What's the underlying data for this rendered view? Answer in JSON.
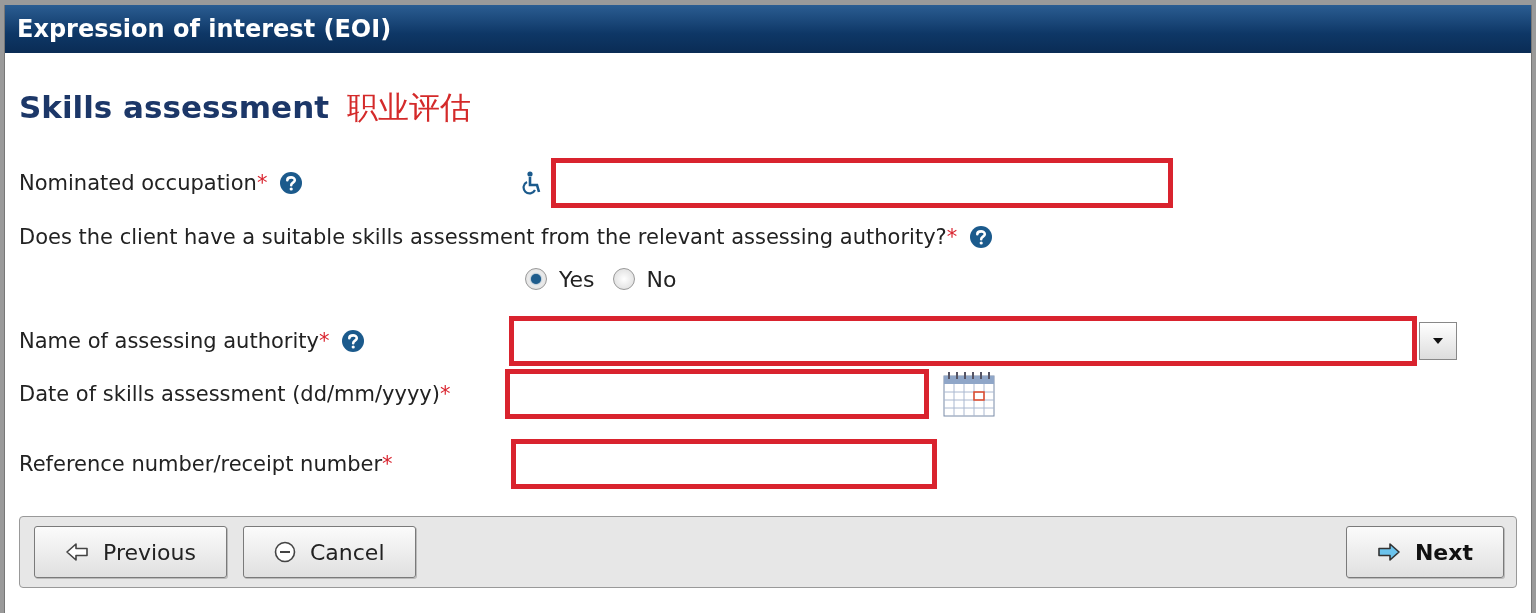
{
  "window": {
    "title": "Expression of interest (EOI)"
  },
  "section": {
    "title": "Skills assessment",
    "annotation": "职业评估"
  },
  "fields": [
    {
      "kind": "text",
      "label": "Nominated occupation",
      "required_mark": "*",
      "help": true,
      "accessible": true,
      "highlighted": true
    },
    {
      "kind": "radio",
      "label": "Does the client have a suitable skills assessment from the relevant assessing authority?",
      "required_mark": "*",
      "help": true,
      "options": [
        {
          "label": "Yes",
          "selected": true
        },
        {
          "label": "No",
          "selected": false
        }
      ]
    },
    {
      "kind": "select",
      "label": "Name of assessing authority",
      "required_mark": "*",
      "help": true,
      "highlighted": true
    },
    {
      "kind": "date",
      "label": "Date of skills assessment (dd/mm/yyyy)",
      "required_mark": "*",
      "help": false,
      "highlighted": true
    },
    {
      "kind": "text",
      "label": "Reference number/receipt number",
      "required_mark": "*",
      "help": false,
      "accessible": false,
      "highlighted": true
    }
  ],
  "buttons": [
    {
      "label": "Previous",
      "kind": "back",
      "primary": false
    },
    {
      "label": "Cancel",
      "kind": "cancel",
      "primary": false
    },
    {
      "label": "Next",
      "kind": "next",
      "primary": true
    }
  ]
}
